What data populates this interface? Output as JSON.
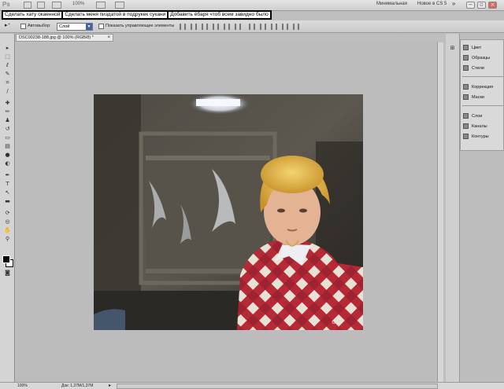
{
  "app": {
    "logo": "Ps",
    "zoom_menu": "100%",
    "workspace_minimal": "Минимальная",
    "workspace_new": "Новое в CS 5",
    "expand": "»"
  },
  "captions": [
    "Сделать хату окаенной",
    "Сделать меня пиздатой в подрукек сукани",
    "Добавить ёбаря чтоб всем завидно было"
  ],
  "options": {
    "auto_select_label": "Автовыбор:",
    "auto_select_value": "Слой",
    "show_controls_label": "Показать управляющие элементы"
  },
  "document": {
    "tab_title": "DSC00238-188.jpg @ 100% (RGB/8) *",
    "close": "×"
  },
  "panels": [
    {
      "label": "Цвет",
      "icon": "color-icon"
    },
    {
      "label": "Образцы",
      "icon": "swatches-icon"
    },
    {
      "label": "Стили",
      "icon": "styles-icon"
    },
    {
      "label": "Коррекция",
      "icon": "adjustments-icon"
    },
    {
      "label": "Маски",
      "icon": "masks-icon"
    },
    {
      "label": "Слои",
      "icon": "layers-icon"
    },
    {
      "label": "Каналы",
      "icon": "channels-icon"
    },
    {
      "label": "Контуры",
      "icon": "paths-icon"
    }
  ],
  "status": {
    "zoom": "100%",
    "doc_info": "Док: 1,37M/1,37M"
  },
  "colors": {
    "foreground": "#000000",
    "background": "#ffffff"
  }
}
